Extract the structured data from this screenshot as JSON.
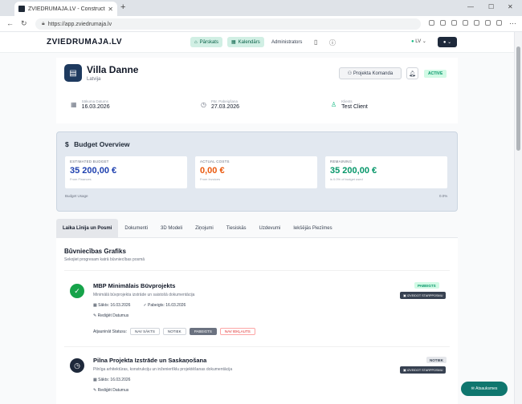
{
  "browser": {
    "tab_title": "ZVIEDRUMAJA.LV - Construction",
    "url": "https://app.zviedrumaja.lv"
  },
  "header": {
    "logo": "ZVIEDRUMAJA.LV",
    "nav": [
      {
        "label": "Pārskats",
        "active": true
      },
      {
        "label": "Kalendārs",
        "active": true
      },
      {
        "label": "Administrators",
        "active": false
      }
    ],
    "language": "LV"
  },
  "project": {
    "name": "Villa Danne",
    "country": "Latvija",
    "team_button": "Projekta Komanda",
    "status": "ACTIVE",
    "start_label": "Sākuma Datums",
    "start_value": "16.03.2026",
    "end_label": "Pār. Pabeigšana",
    "end_value": "27.03.2026",
    "client_label": "Klients",
    "client_value": "Test Client"
  },
  "budget": {
    "title": "Budget Overview",
    "estimated_label": "ESTIMATED BUDGET",
    "estimated_value": "35 200,00 €",
    "estimated_sub": "From Finances",
    "actual_label": "ACTUAL COSTS",
    "actual_value": "0,00 €",
    "actual_sub": "From Invoices",
    "remaining_label": "REMAINING",
    "remaining_value": "35 200,00 €",
    "remaining_sub": "is 0.0% of budget used",
    "usage_label": "Budget Usage",
    "usage_pct": "0.0%",
    "colors": {
      "estimated": "#1e40af",
      "actual": "#ea580c",
      "remaining": "#059669"
    }
  },
  "tabs": [
    {
      "label": "Laika Līnija un Posmi",
      "active": true
    },
    {
      "label": "Dokumenti",
      "active": false
    },
    {
      "label": "3D Modeli",
      "active": false
    },
    {
      "label": "Ziņojumi",
      "active": false
    },
    {
      "label": "Tiesiskās",
      "active": false
    },
    {
      "label": "Uzdevumi",
      "active": false
    },
    {
      "label": "Iekšējās Piezīmes",
      "active": false
    }
  ],
  "schedule": {
    "title": "Būvniecības Grafiks",
    "subtitle": "Sekojiet progresam katrā būvniecības posmā",
    "items": [
      {
        "name": "MBP Minimālais Būvprojekts",
        "desc": "Minimālā būvprojekta izstrāde un saistošā dokumentācija",
        "start": "Sākts: 16.03.2026",
        "end": "Pabeigts: 16.03.2026",
        "edit": "Rediģēt Datumus",
        "status": "PABEIGTS",
        "milestone_btn": "IZVEIDOT STARPPOSMU",
        "status_label": "Atjaunināt Statusu:",
        "chips": [
          "NAV SĀKTS",
          "NOTIEK",
          "PABEIGTS",
          "NAV IEKĻAUTS"
        ]
      },
      {
        "name": "Pilna Projekta Izstrāde un Saskaņošana",
        "desc": "Pilnīga arhitektūras, konstrukciju un inženiertīklu projektēšanas dokumentācija",
        "start": "Sākts: 16.03.2026",
        "edit": "Rediģēt Datumus",
        "status": "NOTIEK",
        "milestone_btn": "IZVEIDOT STARPPOSMU"
      }
    ]
  },
  "fab_label": "Atsauksmes"
}
